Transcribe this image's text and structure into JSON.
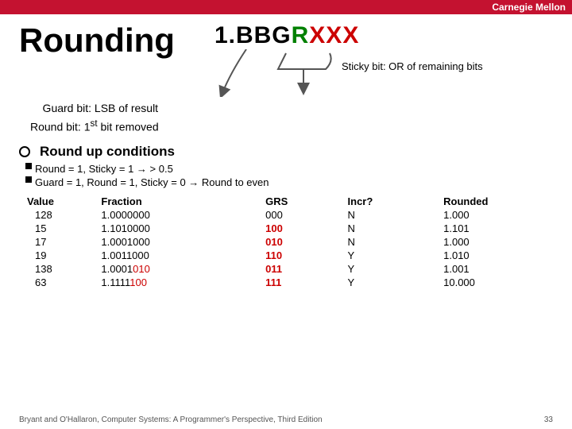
{
  "header": {
    "title": "Carnegie Mellon"
  },
  "page": {
    "title": "Rounding",
    "bit_notation": {
      "prefix": "1.BBG",
      "round": "R",
      "sticky": "XXX"
    },
    "guard_label": "Guard bit: LSB of\n         result",
    "round_label": "Round bit: 1st bit removed",
    "sticky_label": "Sticky bit: OR of remaining bits",
    "round_up_header": "Round up conditions",
    "conditions": [
      "Round = 1, Sticky = 1  →  > 0.5",
      "Guard = 1, Round = 1, Sticky = 0  →  Round to even"
    ],
    "table": {
      "headers": [
        "Value",
        "Fraction",
        "GRS",
        "Incr?",
        "Rounded"
      ],
      "rows": [
        {
          "value": "128",
          "fraction": "1.0000000",
          "frac_colored": false,
          "grs": "000",
          "grs_colored": false,
          "incr": "N",
          "rounded": "1.000"
        },
        {
          "value": "15",
          "fraction": "1.1010000",
          "frac_colored": false,
          "grs": "100",
          "grs_colored": true,
          "incr": "N",
          "rounded": "1.101"
        },
        {
          "value": "17",
          "fraction": "1.0001000",
          "frac_colored": false,
          "grs": "010",
          "grs_colored": true,
          "incr": "N",
          "rounded": "1.000"
        },
        {
          "value": "19",
          "fraction": "1.0011000",
          "frac_colored": false,
          "grs": "110",
          "grs_colored": true,
          "incr": "Y",
          "rounded": "1.010"
        },
        {
          "value": "138",
          "fraction": "1.0001010",
          "frac_colored": true,
          "grs": "011",
          "grs_colored": true,
          "incr": "Y",
          "rounded": "1.001"
        },
        {
          "value": "63",
          "fraction": "1.1111100",
          "frac_colored": true,
          "grs": "111",
          "grs_colored": true,
          "incr": "Y",
          "rounded": "10.000"
        }
      ]
    }
  },
  "footer": {
    "left": "Bryant and O'Hallaron, Computer Systems: A Programmer's Perspective, Third Edition",
    "right": "33"
  }
}
